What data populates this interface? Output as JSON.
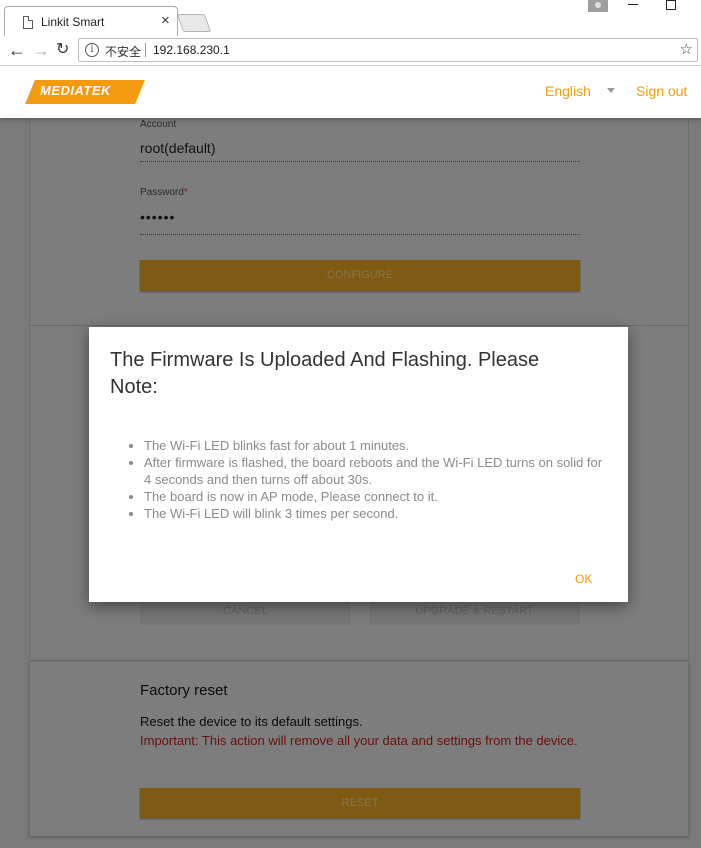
{
  "browser": {
    "tab_title": "Linkit Smart",
    "tab_close": "×",
    "security_label": "不安全",
    "url": "192.168.230.1",
    "min_glyph": "—",
    "max_glyph": "☐"
  },
  "header": {
    "logo_text": "MEDIATEK",
    "language": "English",
    "sign_out": "Sign out",
    "accent_color": "#f0a000"
  },
  "account_form": {
    "account_label": "Account",
    "account_value": "root(default)",
    "password_label": "Password",
    "password_required": "*",
    "password_value": "••••••",
    "configure_button": "CONFIGURE"
  },
  "firmware_section": {
    "cancel_button": "CANCEL",
    "upgrade_button": "UPGRADE & RESTART"
  },
  "factory_reset": {
    "title": "Factory reset",
    "description": "Reset the device to its default settings.",
    "warning": "Important: This action will remove all your data and settings from the device.",
    "reset_button": "RESET"
  },
  "dialog": {
    "title": "The Firmware Is Uploaded And Flashing. Please Note:",
    "items": [
      "The Wi-Fi LED blinks fast for about 1 minutes.",
      "After firmware is flashed, the board reboots and the Wi-Fi LED turns on solid for 4 seconds and then turns off about 30s.",
      "The board is now in AP mode, Please connect to it.",
      "The Wi-Fi LED will blink 3 times per second."
    ],
    "ok_button": "OK"
  }
}
